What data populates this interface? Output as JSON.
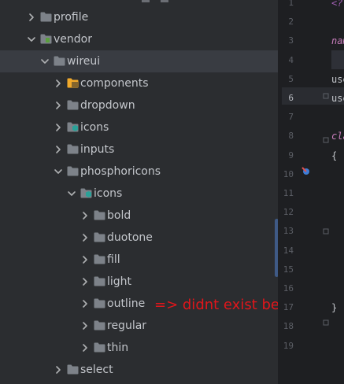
{
  "tree": {
    "items": [
      {
        "label": "profile",
        "depth": 0,
        "expanded": false,
        "folder": "plain",
        "selected": false
      },
      {
        "label": "vendor",
        "depth": 0,
        "expanded": true,
        "folder": "package",
        "selected": false
      },
      {
        "label": "wireui",
        "depth": 1,
        "expanded": true,
        "folder": "plain",
        "selected": true
      },
      {
        "label": "components",
        "depth": 2,
        "expanded": false,
        "folder": "components",
        "selected": false
      },
      {
        "label": "dropdown",
        "depth": 2,
        "expanded": false,
        "folder": "plain",
        "selected": false
      },
      {
        "label": "icons",
        "depth": 2,
        "expanded": false,
        "folder": "resource",
        "selected": false
      },
      {
        "label": "inputs",
        "depth": 2,
        "expanded": false,
        "folder": "plain",
        "selected": false
      },
      {
        "label": "phosphoricons",
        "depth": 2,
        "expanded": true,
        "folder": "plain",
        "selected": false
      },
      {
        "label": "icons",
        "depth": 3,
        "expanded": true,
        "folder": "resource",
        "selected": false
      },
      {
        "label": "bold",
        "depth": 4,
        "expanded": false,
        "folder": "plain",
        "selected": false
      },
      {
        "label": "duotone",
        "depth": 4,
        "expanded": false,
        "folder": "plain",
        "selected": false
      },
      {
        "label": "fill",
        "depth": 4,
        "expanded": false,
        "folder": "plain",
        "selected": false
      },
      {
        "label": "light",
        "depth": 4,
        "expanded": false,
        "folder": "plain",
        "selected": false
      },
      {
        "label": "outline",
        "depth": 4,
        "expanded": false,
        "folder": "plain",
        "selected": false
      },
      {
        "label": "regular",
        "depth": 4,
        "expanded": false,
        "folder": "plain",
        "selected": false
      },
      {
        "label": "thin",
        "depth": 4,
        "expanded": false,
        "folder": "plain",
        "selected": false
      },
      {
        "label": "select",
        "depth": 2,
        "expanded": false,
        "folder": "plain",
        "selected": false
      }
    ]
  },
  "annotation": {
    "text": "=> didnt exist before",
    "color": "#e0161b"
  },
  "editor": {
    "line_numbers": [
      "1",
      "2",
      "3",
      "4",
      "5",
      "6",
      "7",
      "8",
      "9",
      "10",
      "11",
      "12",
      "13",
      "14",
      "15",
      "16",
      "17",
      "18",
      "19"
    ],
    "current_line": "6",
    "visible_code": [
      {
        "line": "1",
        "text": "<?",
        "color": "#a15fb3",
        "italic": true
      },
      {
        "line": "3",
        "text": "nam",
        "color": "#c77dbb",
        "italic": true
      },
      {
        "line": "5",
        "text": "use",
        "color": "#c3c6cb",
        "italic": false
      },
      {
        "line": "6",
        "text": "use",
        "color": "#c3c6cb",
        "italic": false
      },
      {
        "line": "8",
        "text": "cla",
        "color": "#c77dbb",
        "italic": true
      },
      {
        "line": "9",
        "text": "{",
        "color": "#c3c6cb",
        "italic": false
      },
      {
        "line": "17",
        "text": "}",
        "color": "#c3c6cb",
        "italic": false
      }
    ]
  },
  "colors": {
    "folder": "#7d8289",
    "folder_package": "#5a9e3e",
    "folder_resource": "#2aa198",
    "folder_components": "#f0a92b",
    "chevron": "#afb1b3"
  },
  "icons": {
    "chevron_collapsed": "chevron-right-icon",
    "chevron_expanded": "chevron-down-icon",
    "folder": "folder-icon",
    "gutter_marker": "implements-icon"
  }
}
